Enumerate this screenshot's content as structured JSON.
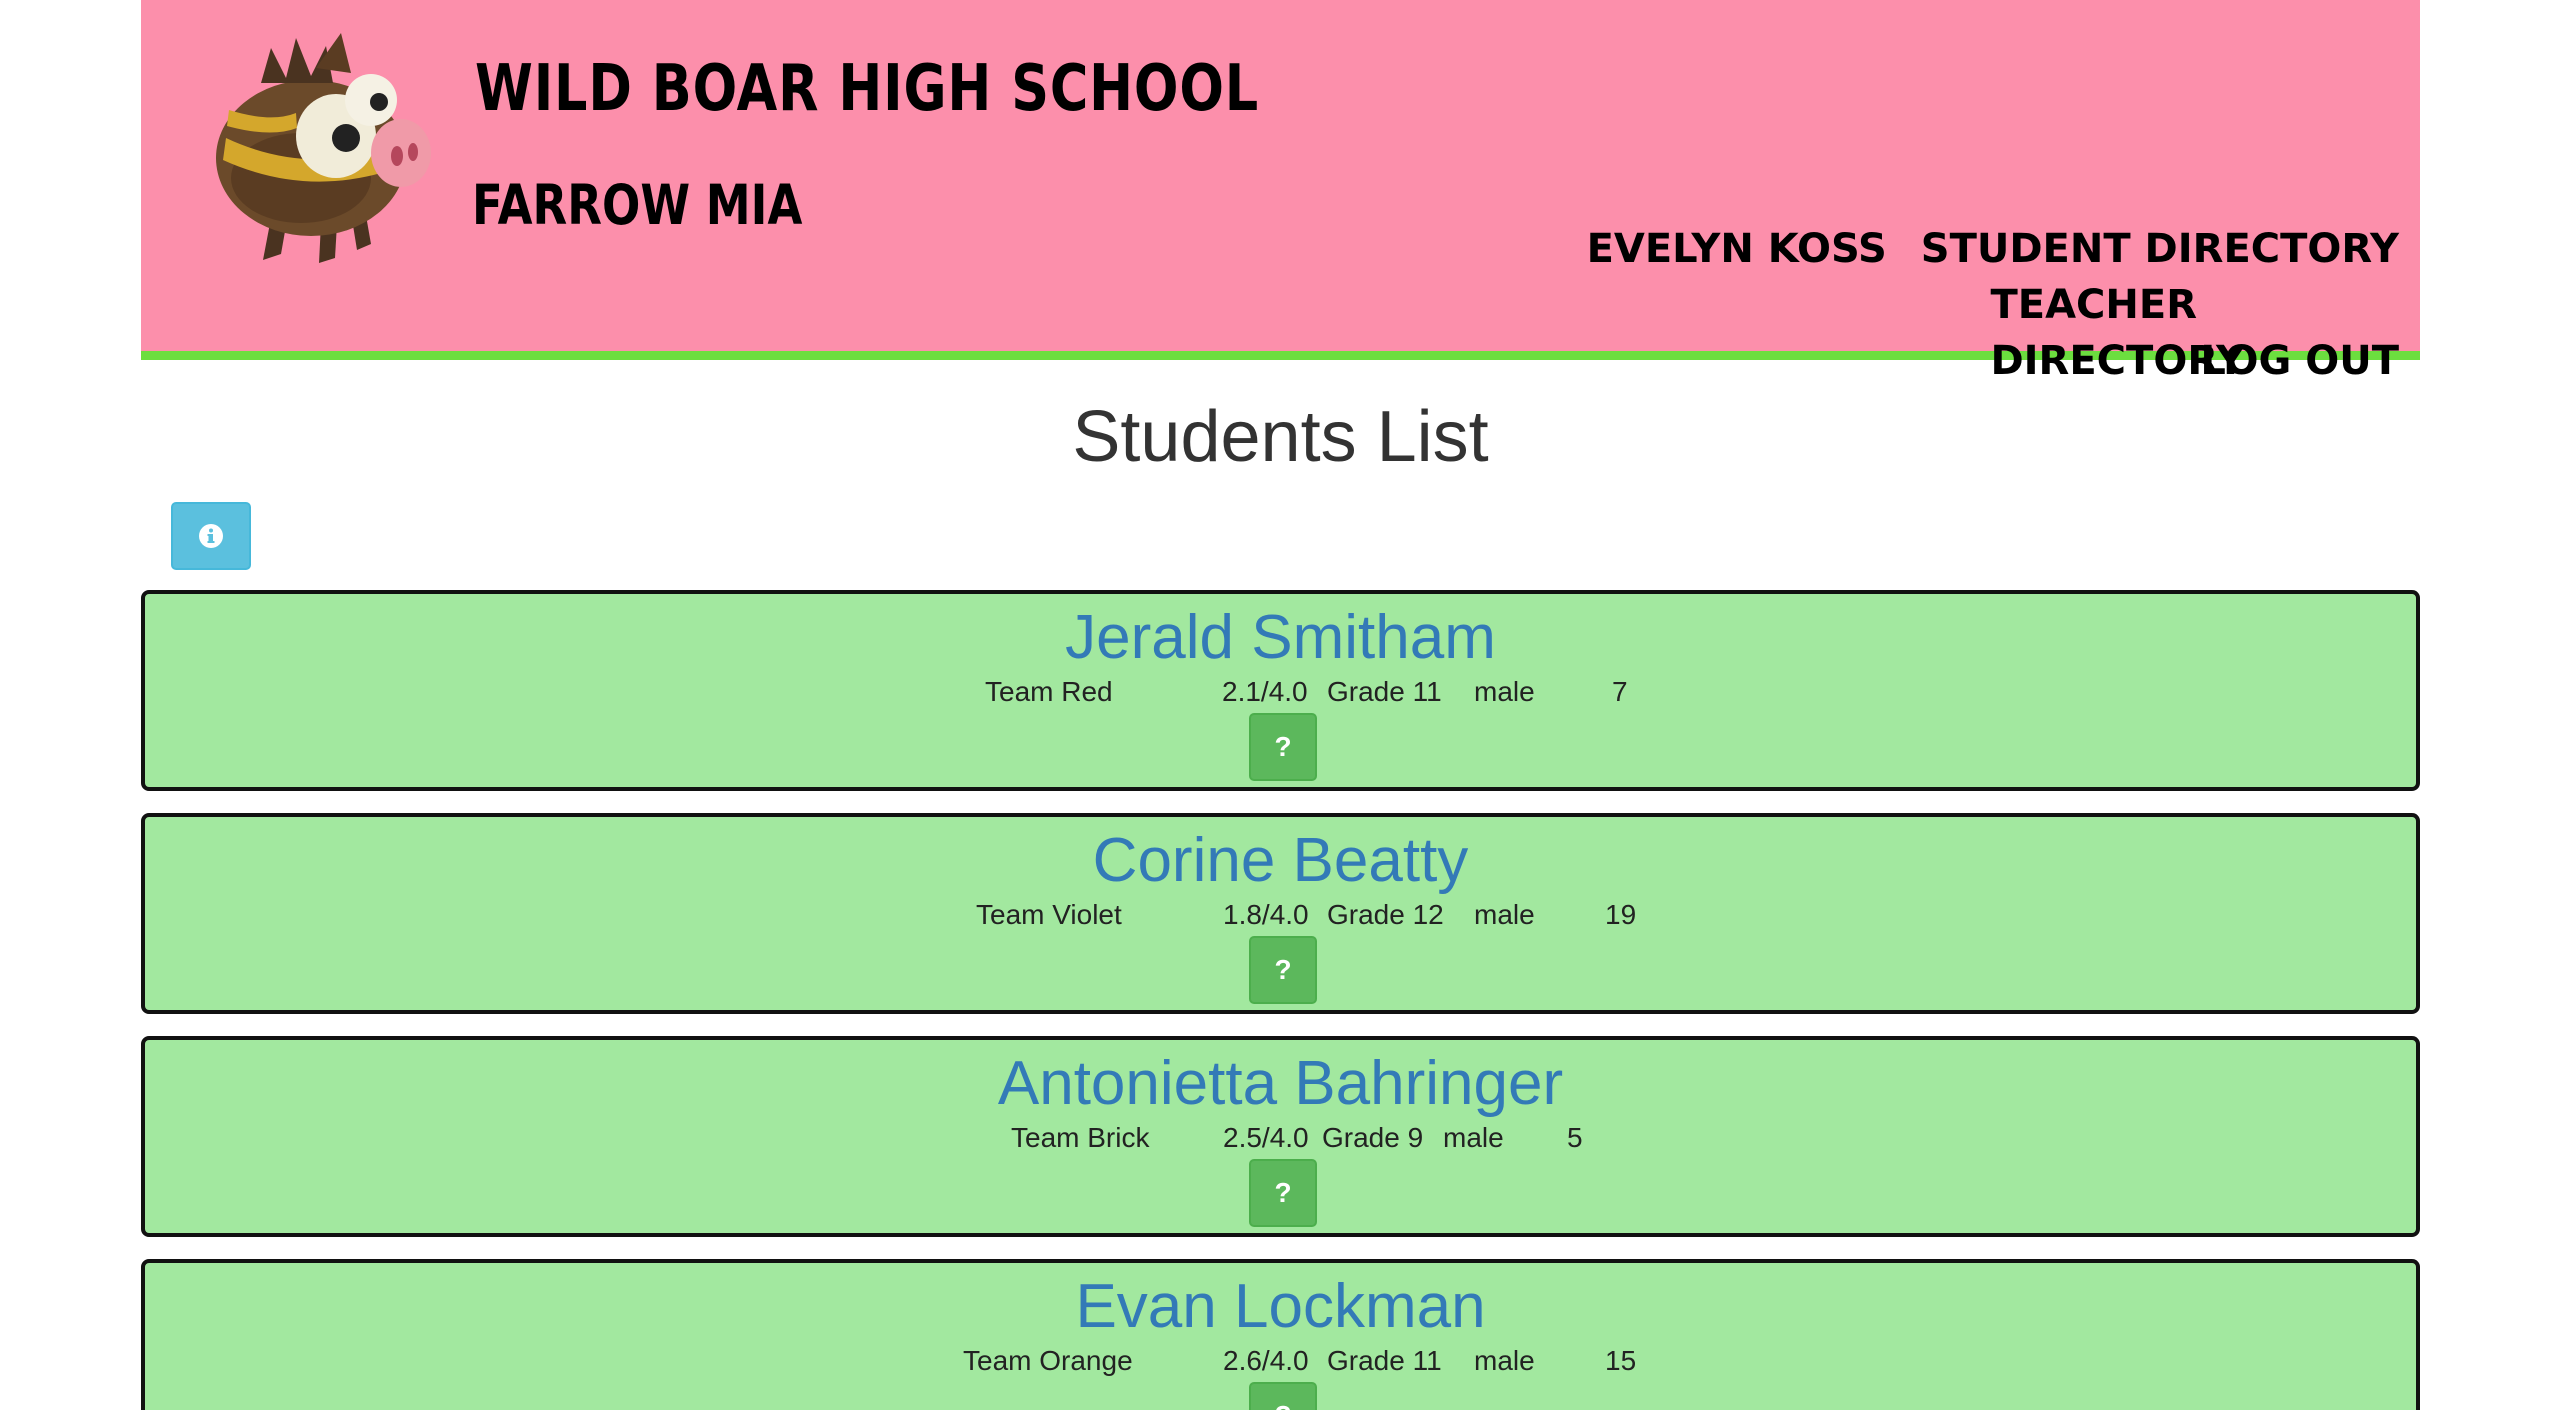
{
  "header": {
    "school_name": "WILD BOAR HIGH SCHOOL",
    "student_name": "FARROW MIA",
    "nav": {
      "user": "EVELYN KOSS",
      "student_directory": "STUDENT DIRECTORY",
      "teacher_directory": "TEACHER DIRECTORY",
      "log_out": "LOG OUT"
    },
    "colors": {
      "background": "#fc8fab",
      "accent_border": "#6cde3f"
    }
  },
  "main": {
    "title": "Students List",
    "info_button_icon": "info-circle-icon",
    "help_button_label": "?",
    "card_color": "#a2e89f",
    "students": [
      {
        "name": "Jerald Smitham",
        "team": "Team Red",
        "gpa": "2.1/4.0",
        "grade": "Grade 11",
        "gender": "male",
        "number": "7"
      },
      {
        "name": "Corine Beatty",
        "team": "Team Violet",
        "gpa": "1.8/4.0",
        "grade": "Grade 12",
        "gender": "male",
        "number": "19"
      },
      {
        "name": "Antonietta Bahringer",
        "team": "Team Brick",
        "gpa": "2.5/4.0",
        "grade": "Grade 9",
        "gender": "male",
        "number": "5"
      },
      {
        "name": "Evan Lockman",
        "team": "Team Orange",
        "gpa": "2.6/4.0",
        "grade": "Grade 11",
        "gender": "male",
        "number": "15"
      }
    ]
  }
}
